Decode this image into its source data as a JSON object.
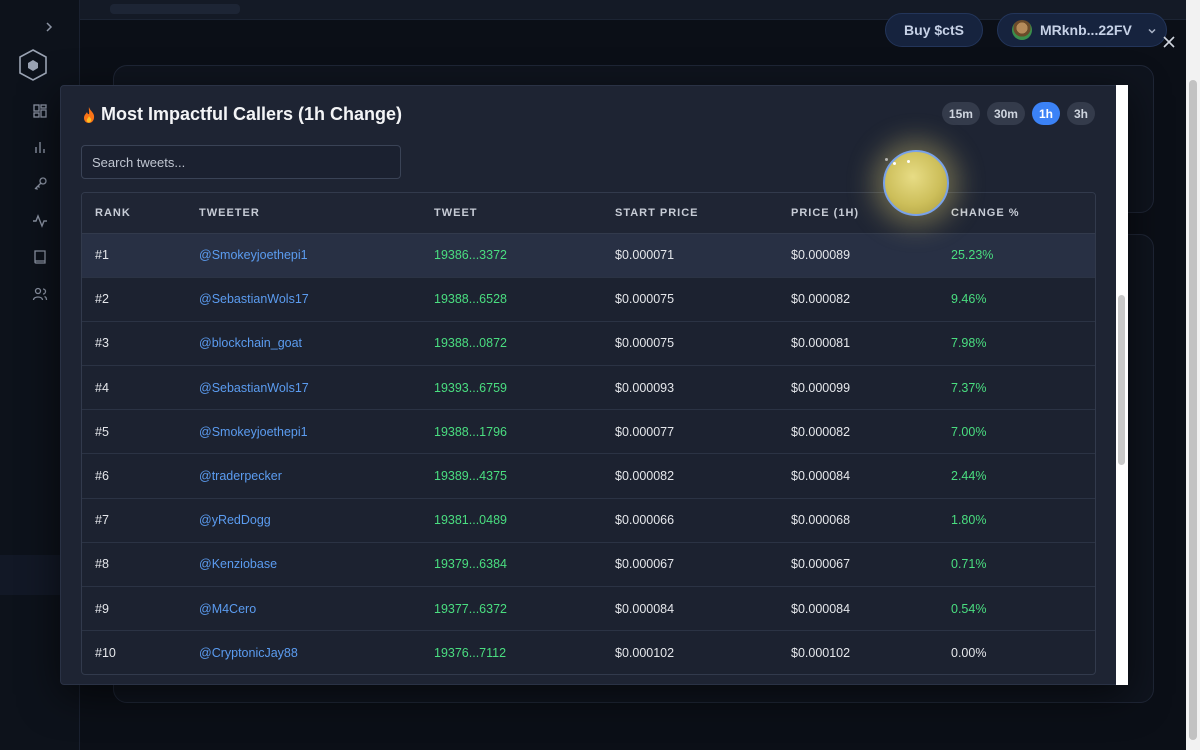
{
  "header": {
    "buy_label": "Buy $ctS",
    "wallet_label": "MRknb...22FV"
  },
  "sidebar": {
    "items": [
      {
        "icon": "dashboard-icon"
      },
      {
        "icon": "bar-chart-icon"
      },
      {
        "icon": "key-icon"
      },
      {
        "icon": "activity-icon"
      },
      {
        "icon": "book-icon"
      },
      {
        "icon": "users-icon"
      }
    ]
  },
  "modal": {
    "title": "Most Impactful Callers (1h Change)",
    "title_icon": "fire-icon",
    "timeframes": [
      {
        "label": "15m",
        "active": false
      },
      {
        "label": "30m",
        "active": false
      },
      {
        "label": "1h",
        "active": true
      },
      {
        "label": "3h",
        "active": false
      }
    ],
    "search_placeholder": "Search tweets...",
    "columns": [
      "RANK",
      "TWEETER",
      "TWEET",
      "START PRICE",
      "PRICE (1H)",
      "CHANGE %"
    ],
    "rows": [
      {
        "rank": "#1",
        "tweeter": "@Smokeyjoethepi1",
        "tweet": "19386...3372",
        "start": "$0.000071",
        "price": "$0.000089",
        "change": "25.23%"
      },
      {
        "rank": "#2",
        "tweeter": "@SebastianWols17",
        "tweet": "19388...6528",
        "start": "$0.000075",
        "price": "$0.000082",
        "change": "9.46%"
      },
      {
        "rank": "#3",
        "tweeter": "@blockchain_goat",
        "tweet": "19388...0872",
        "start": "$0.000075",
        "price": "$0.000081",
        "change": "7.98%"
      },
      {
        "rank": "#4",
        "tweeter": "@SebastianWols17",
        "tweet": "19393...6759",
        "start": "$0.000093",
        "price": "$0.000099",
        "change": "7.37%"
      },
      {
        "rank": "#5",
        "tweeter": "@Smokeyjoethepi1",
        "tweet": "19388...1796",
        "start": "$0.000077",
        "price": "$0.000082",
        "change": "7.00%"
      },
      {
        "rank": "#6",
        "tweeter": "@traderpecker",
        "tweet": "19389...4375",
        "start": "$0.000082",
        "price": "$0.000084",
        "change": "2.44%"
      },
      {
        "rank": "#7",
        "tweeter": "@yRedDogg",
        "tweet": "19381...0489",
        "start": "$0.000066",
        "price": "$0.000068",
        "change": "1.80%"
      },
      {
        "rank": "#8",
        "tweeter": "@Kenziobase",
        "tweet": "19379...6384",
        "start": "$0.000067",
        "price": "$0.000067",
        "change": "0.71%"
      },
      {
        "rank": "#9",
        "tweeter": "@M4Cero",
        "tweet": "19377...6372",
        "start": "$0.000084",
        "price": "$0.000084",
        "change": "0.54%"
      },
      {
        "rank": "#10",
        "tweeter": "@CryptonicJay88",
        "tweet": "19376...7112",
        "start": "$0.000102",
        "price": "$0.000102",
        "change": "0.00%"
      }
    ]
  },
  "colors": {
    "accent": "#3b82f6",
    "positive": "#4ade80",
    "link": "#5b9cf0",
    "background": "#0b0f17",
    "modal": "#1e2433"
  }
}
